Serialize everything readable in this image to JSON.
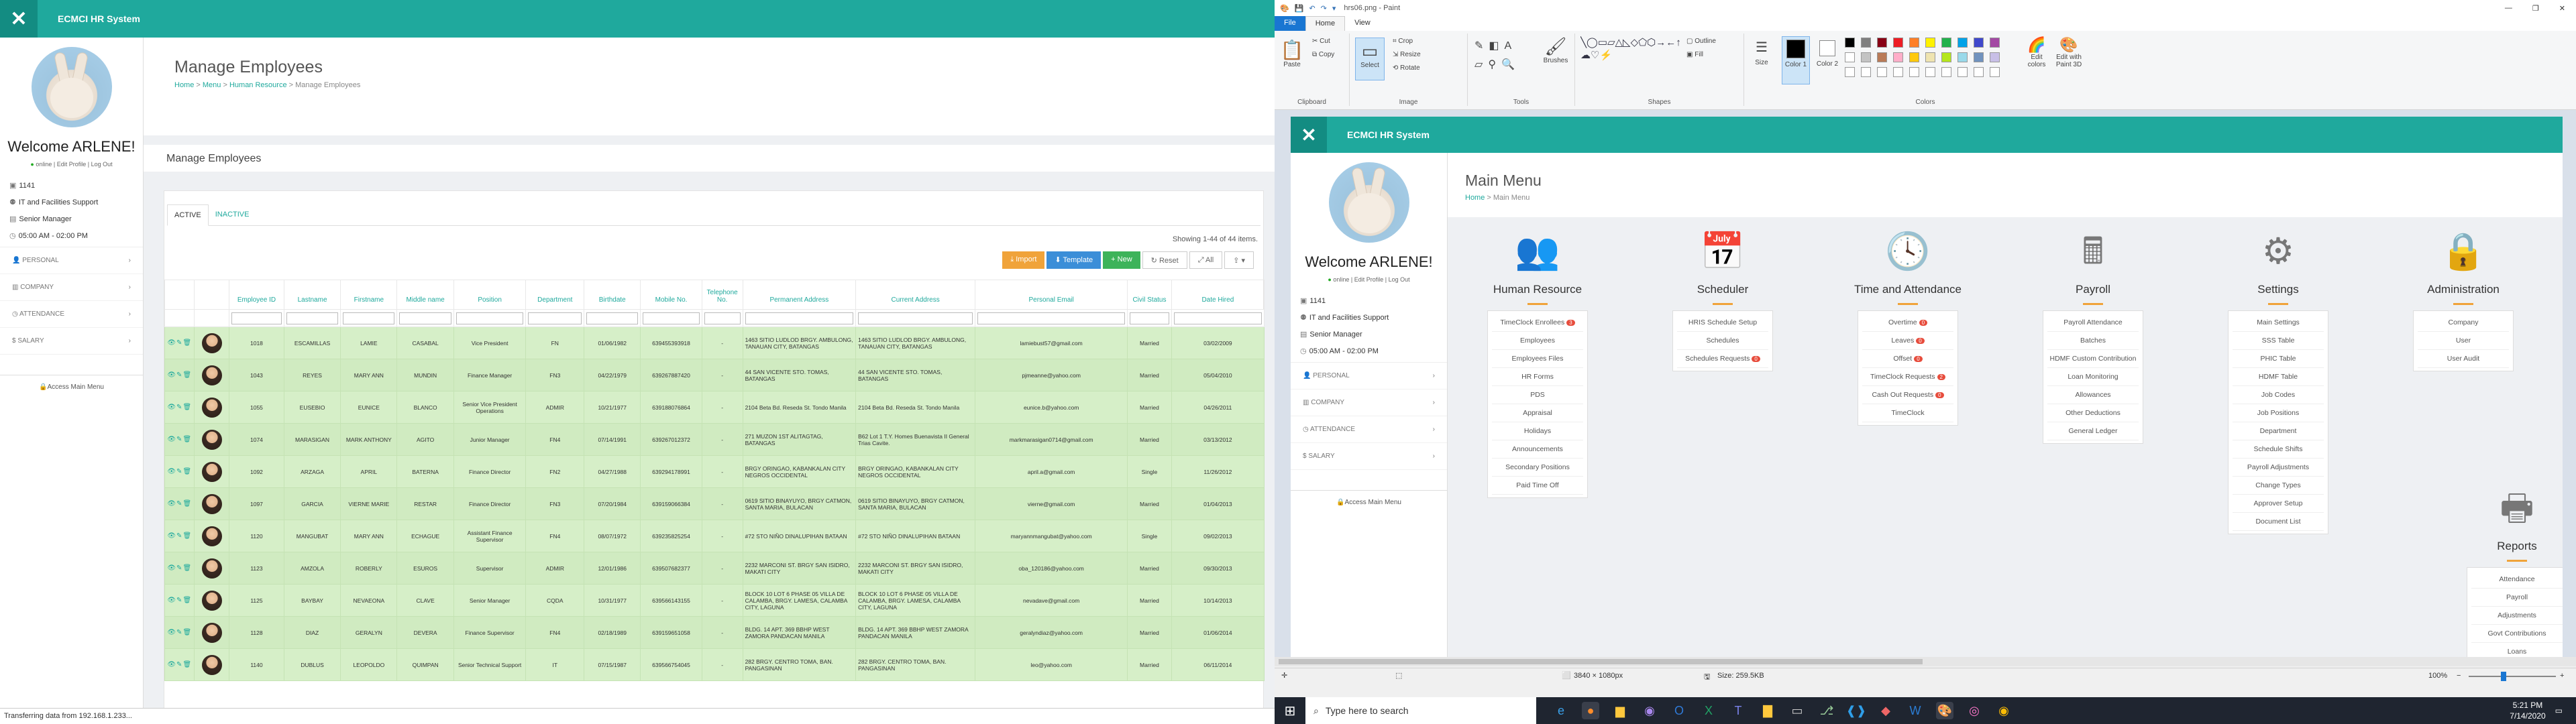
{
  "browser": {
    "app_title": "ECMCI HR System",
    "status_bar": "Transferring data from 192.168.1.233..."
  },
  "sidebar": {
    "welcome": "Welcome ARLENE!",
    "online": "online",
    "edit_profile": "Edit Profile",
    "logout": "Log Out",
    "emp_id": "1141",
    "department": "IT and Facilities Support",
    "position": "Senior Manager",
    "schedule": "05:00 AM - 02:00 PM",
    "menu": [
      "PERSONAL",
      "COMPANY",
      "ATTENDANCE",
      "SALARY"
    ],
    "access_main_menu": "Access Main Menu"
  },
  "page": {
    "title": "Manage Employees",
    "breadcrumb": [
      "Home",
      "Menu",
      "Human Resource",
      "Manage Employees"
    ],
    "section_title": "Manage Employees",
    "tabs": [
      "ACTIVE",
      "INACTIVE"
    ],
    "showing": "Showing 1-44 of 44 items.",
    "buttons": {
      "import": "Import",
      "template": "Template",
      "new": "New",
      "reset": "Reset",
      "all": "All"
    }
  },
  "table": {
    "columns": [
      "Employee ID",
      "Lastname",
      "Firstname",
      "Middle name",
      "Position",
      "Department",
      "Birthdate",
      "Mobile No.",
      "Telephone No.",
      "Permanent Address",
      "Current Address",
      "Personal Email",
      "Civil Status",
      "Date Hired"
    ],
    "rows": [
      [
        "1018",
        "ESCAMILLAS",
        "LAMIE",
        "CASABAL",
        "Vice President",
        "FN",
        "01/06/1982",
        "639455393918",
        "-",
        "1463 SITIO LUDLOD BRGY. AMBULONG, TANAUAN CITY, BATANGAS",
        "1463 SITIO LUDLOD BRGY. AMBULONG, TANAUAN CITY, BATANGAS",
        "lamiebust57@gmail.com",
        "Married",
        "03/02/2009"
      ],
      [
        "1043",
        "REYES",
        "MARY ANN",
        "MUNDIN",
        "Finance Manager",
        "FN3",
        "04/22/1979",
        "639267887420",
        "-",
        "44 SAN VICENTE STO. TOMAS, BATANGAS",
        "44 SAN VICENTE STO. TOMAS, BATANGAS",
        "pjmeanne@yahoo.com",
        "Married",
        "05/04/2010"
      ],
      [
        "1055",
        "EUSEBIO",
        "EUNICE",
        "BLANCO",
        "Senior Vice President Operations",
        "ADMIR",
        "10/21/1977",
        "639188076864",
        "-",
        "2104 Beta Bd. Reseda St. Tondo Manila",
        "2104 Beta Bd. Reseda St. Tondo Manila",
        "eunice.b@yahoo.com",
        "Married",
        "04/26/2011"
      ],
      [
        "1074",
        "MARASIGAN",
        "MARK ANTHONY",
        "AGITO",
        "Junior Manager",
        "FN4",
        "07/14/1991",
        "639267012372",
        "-",
        "271 MUZON 1ST ALITAGTAG, BATANGAS",
        "B62 Lot 1 T.Y. Homes Buenavista II General Trias Cavite.",
        "markmarasigan0714@gmail.com",
        "Married",
        "03/13/2012"
      ],
      [
        "1092",
        "ARZAGA",
        "APRIL",
        "BATERNA",
        "Finance Director",
        "FN2",
        "04/27/1988",
        "639294178991",
        "-",
        "BRGY ORINGAO, KABANKALAN CITY NEGROS OCCIDENTAL",
        "BRGY ORINGAO, KABANKALAN CITY NEGROS OCCIDENTAL",
        "april.a@gmail.com",
        "Single",
        "11/26/2012"
      ],
      [
        "1097",
        "GARCIA",
        "VIERNE MARIE",
        "RESTAR",
        "Finance Director",
        "FN3",
        "07/20/1984",
        "639159066384",
        "-",
        "0619 SITIO BINAYUYO, BRGY CATMON, SANTA MARIA, BULACAN",
        "0619 SITIO BINAYUYO, BRGY CATMON, SANTA MARIA, BULACAN",
        "vierne@gmail.com",
        "Married",
        "01/04/2013"
      ],
      [
        "1120",
        "MANGUBAT",
        "MARY ANN",
        "ECHAGUE",
        "Assistant Finance Supervisor",
        "FN4",
        "08/07/1972",
        "639235825254",
        "-",
        "#72 STO NIÑO DINALUPIHAN BATAAN",
        "#72 STO NIÑO DINALUPIHAN BATAAN",
        "maryannmangubat@yahoo.com",
        "Single",
        "09/02/2013"
      ],
      [
        "1123",
        "AMZOLA",
        "ROBERLY",
        "ESUROS",
        "Supervisor",
        "ADMIR",
        "12/01/1986",
        "639507682377",
        "-",
        "2232 MARCONI ST. BRGY SAN ISIDRO, MAKATI CITY",
        "2232 MARCONI ST. BRGY SAN ISIDRO, MAKATI CITY",
        "oba_120186@yahoo.com",
        "Married",
        "09/30/2013"
      ],
      [
        "1125",
        "BAYBAY",
        "NEVAEONA",
        "CLAVE",
        "Senior Manager",
        "CQDA",
        "10/31/1977",
        "639566143155",
        "-",
        "BLOCK 10 LOT 6 PHASE 05 VILLA DE CALAMBA, BRGY. LAMESA, CALAMBA CITY, LAGUNA",
        "BLOCK 10 LOT 6 PHASE 05 VILLA DE CALAMBA, BRGY. LAMESA, CALAMBA CITY, LAGUNA",
        "nevadave@gmail.com",
        "Married",
        "10/14/2013"
      ],
      [
        "1128",
        "DIAZ",
        "GERALYN",
        "DEVERA",
        "Finance Supervisor",
        "FN4",
        "02/18/1989",
        "639159651058",
        "-",
        "BLDG. 14 APT. 369 BBHP WEST ZAMORA PANDACAN MANILA",
        "BLDG. 14 APT. 369 BBHP WEST ZAMORA PANDACAN MANILA",
        "geralyndiaz@yahoo.com",
        "Married",
        "01/06/2014"
      ],
      [
        "1140",
        "DUBLUS",
        "LEOPOLDO",
        "QUIMPAN",
        "Senior Technical Support",
        "IT",
        "07/15/1987",
        "639566754045",
        "-",
        "282 BRGY. CENTRO TOMA, BAN. PANGASINAN",
        "282 BRGY. CENTRO TOMA, BAN. PANGASINAN",
        "leo@yahoo.com",
        "Married",
        "06/11/2014"
      ]
    ]
  },
  "paint": {
    "title": "hrs06.png - Paint",
    "menu": [
      "File",
      "Home",
      "View"
    ],
    "groups": [
      "Clipboard",
      "Image",
      "Tools",
      "Shapes",
      "Colors"
    ],
    "clipboard": {
      "paste": "Paste",
      "cut": "Cut",
      "copy": "Copy"
    },
    "image": {
      "select": "Select",
      "crop": "Crop",
      "resize": "Resize",
      "rotate": "Rotate"
    },
    "brushes": "Brushes",
    "outline": "Outline",
    "fill": "Fill",
    "size": "Size",
    "color1": "Color 1",
    "color2": "Color 2",
    "edit_colors": "Edit colors",
    "edit_paint3d": "Edit with Paint 3D",
    "dimensions": "3840 × 1080px",
    "filesize": "Size: 259.5KB",
    "zoom": "100%",
    "palette": [
      "#000000",
      "#7f7f7f",
      "#880015",
      "#ed1c24",
      "#ff7f27",
      "#fff200",
      "#22b14c",
      "#00a2e8",
      "#3f48cc",
      "#a349a4",
      "#ffffff",
      "#c3c3c3",
      "#b97a57",
      "#ffaec9",
      "#ffc90e",
      "#efe4b0",
      "#b5e61d",
      "#99d9ea",
      "#7092be",
      "#c8bfe7"
    ]
  },
  "inner": {
    "app_title": "ECMCI HR System",
    "welcome": "Welcome ARLENE!",
    "online": "online",
    "edit_profile": "Edit Profile",
    "logout": "Log Out",
    "emp_id": "1141",
    "department": "IT and Facilities Support",
    "position": "Senior Manager",
    "schedule": "05:00 AM - 02:00 PM",
    "menu": [
      "PERSONAL",
      "COMPANY",
      "ATTENDANCE",
      "SALARY"
    ],
    "access_main_menu": "Access Main Menu",
    "title": "Main Menu",
    "breadcrumb": [
      "Home",
      "Main Menu"
    ],
    "modules": [
      {
        "name": "Human Resource",
        "icon": "users-icon",
        "items": [
          [
            "TimeClock Enrollees",
            "3"
          ],
          [
            "Employees",
            ""
          ],
          [
            "Employees Files",
            ""
          ],
          [
            "HR Forms",
            ""
          ],
          [
            "PDS",
            ""
          ],
          [
            "Appraisal",
            ""
          ],
          [
            "Holidays",
            ""
          ],
          [
            "Announcements",
            ""
          ],
          [
            "Secondary Positions",
            ""
          ],
          [
            "Paid Time Off",
            ""
          ]
        ]
      },
      {
        "name": "Scheduler",
        "icon": "calendar-icon",
        "items": [
          [
            "HRIS Schedule Setup",
            ""
          ],
          [
            "Schedules",
            ""
          ],
          [
            "Schedules Requests",
            "0"
          ]
        ]
      },
      {
        "name": "Time and Attendance",
        "icon": "clock-icon",
        "items": [
          [
            "Overtime",
            "0"
          ],
          [
            "Leaves",
            "0"
          ],
          [
            "Offset",
            "0"
          ],
          [
            "TimeClock Requests",
            "2"
          ],
          [
            "Cash Out Requests",
            "0"
          ],
          [
            "TimeClock",
            ""
          ]
        ]
      },
      {
        "name": "Payroll",
        "icon": "calculator-icon",
        "items": [
          [
            "Payroll Attendance",
            ""
          ],
          [
            "Batches",
            ""
          ],
          [
            "HDMF Custom Contribution",
            ""
          ],
          [
            "Loan Monitoring",
            ""
          ],
          [
            "Allowances",
            ""
          ],
          [
            "Other Deductions",
            ""
          ],
          [
            "General Ledger",
            ""
          ]
        ]
      },
      {
        "name": "Settings",
        "icon": "gear-icon",
        "items": [
          [
            "Main Settings",
            ""
          ],
          [
            "SSS Table",
            ""
          ],
          [
            "PHIC Table",
            ""
          ],
          [
            "HDMF Table",
            ""
          ],
          [
            "Job Codes",
            ""
          ],
          [
            "Job Positions",
            ""
          ],
          [
            "Department",
            ""
          ],
          [
            "Schedule Shifts",
            ""
          ],
          [
            "Payroll Adjustments",
            ""
          ],
          [
            "Change Types",
            ""
          ],
          [
            "Approver Setup",
            ""
          ],
          [
            "Document List",
            ""
          ]
        ]
      },
      {
        "name": "Administration",
        "icon": "lock-icon",
        "items": [
          [
            "Company",
            ""
          ],
          [
            "User",
            ""
          ],
          [
            "User Audit",
            ""
          ]
        ]
      }
    ],
    "reports": {
      "name": "Reports",
      "items": [
        "Attendance",
        "Payroll",
        "Adjustments",
        "Govt Contributions",
        "Loans"
      ]
    }
  },
  "taskbar": {
    "search_placeholder": "Type here to search",
    "time": "5:21 PM",
    "date": "7/14/2020"
  }
}
